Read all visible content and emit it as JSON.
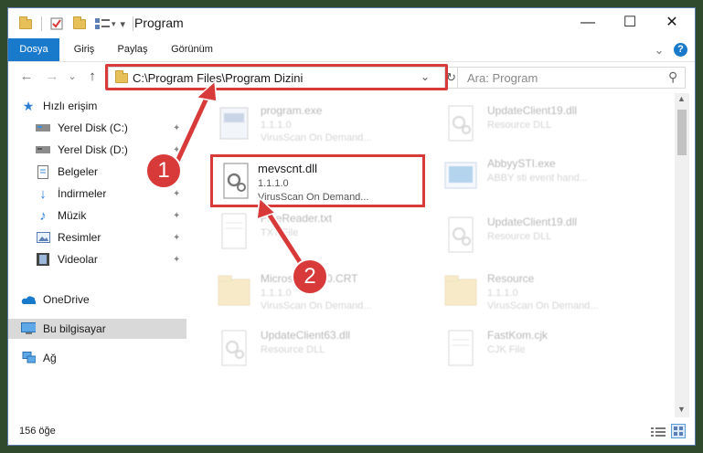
{
  "window": {
    "title": "Program",
    "controls": {
      "minimize": "—",
      "maximize": "☐",
      "close": "✕"
    }
  },
  "ribbon": {
    "tabs": [
      "Dosya",
      "Giriş",
      "Paylaş",
      "Görünüm"
    ],
    "collapse": "⌄",
    "help": "?"
  },
  "nav": {
    "back": "←",
    "forward": "→",
    "history": "⌄",
    "up": "↑",
    "address": "C:\\Program Files\\Program Dizini",
    "address_dropdown": "⌄",
    "refresh": "↻",
    "search_placeholder": "Ara: Program",
    "search_icon": "⚲"
  },
  "sidebar": {
    "quick_access": "Hızlı erişim",
    "items": [
      {
        "label": "Yerel Disk (C:)",
        "icon": "drive-c-icon"
      },
      {
        "label": "Yerel Disk (D:)",
        "icon": "drive-d-icon"
      },
      {
        "label": "Belgeler",
        "icon": "documents-icon"
      },
      {
        "label": "İndirmeler",
        "icon": "downloads-icon"
      },
      {
        "label": "Müzik",
        "icon": "music-icon"
      },
      {
        "label": "Resimler",
        "icon": "pictures-icon"
      },
      {
        "label": "Videolar",
        "icon": "videos-icon"
      }
    ],
    "pin_glyph": "📌",
    "onedrive": "OneDrive",
    "this_pc": "Bu bilgisayar",
    "network": "Ağ"
  },
  "files": {
    "left": [
      {
        "name": "program.exe",
        "line1": "1.1.1.0",
        "line2": "VirusScan On Demand..."
      },
      {
        "name": "FineReader.txt",
        "line1": "TXT File",
        "line2": ""
      },
      {
        "name": "MicrosoftVC90.CRT",
        "line1": "1.1.1.0",
        "line2": "VirusScan On Demand..."
      },
      {
        "name": "UpdateClient63.dll",
        "line1": "Resource DLL",
        "line2": ""
      }
    ],
    "right": [
      {
        "name": "UpdateClient19.dll",
        "line1": "Resource DLL",
        "line2": ""
      },
      {
        "name": "AbbyySTI.exe",
        "line1": "ABBY sti event hand...",
        "line2": ""
      },
      {
        "name": "UpdateClient19.dll",
        "line1": "Resource DLL",
        "line2": ""
      },
      {
        "name": "Resource",
        "line1": "1.1.1.0",
        "line2": "VirusScan On Demand..."
      },
      {
        "name": "FastKom.cjk",
        "line1": "CJK File",
        "line2": ""
      }
    ],
    "highlighted": {
      "name": "mevscnt.dll",
      "line1": "1.1.1.0",
      "line2": "VirusScan On Demand..."
    }
  },
  "status": {
    "count": "156 öğe"
  },
  "annotations": {
    "step1": "1",
    "step2": "2",
    "color": "#d83a3a"
  },
  "colors": {
    "accent": "#1979ca"
  }
}
